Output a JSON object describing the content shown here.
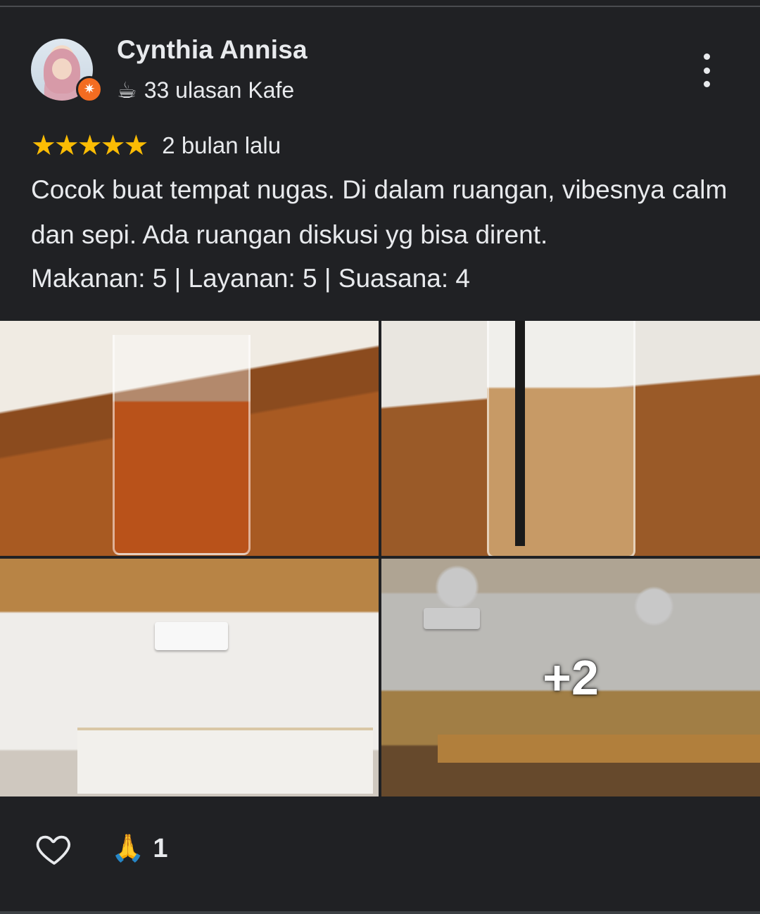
{
  "review": {
    "author": "Cynthia Annisa",
    "meta_icon": "☕",
    "meta_text": "33 ulasan Kafe",
    "rating_stars": "★★★★★",
    "rating_value": 5,
    "time_ago": "2 bulan lalu",
    "text": "Cocok buat tempat nugas. Di dalam ruangan, vibesnya calm dan sepi. Ada ruangan diskusi yg bisa dirent.",
    "scores": "Makanan: 5 | Layanan: 5 | Suasana: 4"
  },
  "photos": {
    "more_count": "+2"
  },
  "actions": {
    "reaction_emoji": "🙏",
    "reaction_count": "1"
  },
  "colors": {
    "background": "#202124",
    "text": "#e8eaed",
    "star": "#fbbc04",
    "badge": "#f36c21"
  }
}
